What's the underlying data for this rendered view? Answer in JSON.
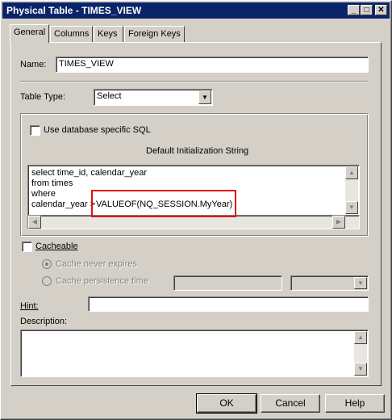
{
  "window": {
    "title": "Physical Table - TIMES_VIEW",
    "minimize_glyph": "_",
    "maximize_glyph": "□",
    "close_glyph": "✕"
  },
  "tabs": [
    {
      "label": "General"
    },
    {
      "label": "Columns"
    },
    {
      "label": "Keys"
    },
    {
      "label": "Foreign Keys"
    }
  ],
  "name": {
    "label": "Name:",
    "value": "TIMES_VIEW"
  },
  "table_type": {
    "label": "Table Type:",
    "value": "Select"
  },
  "sql_group": {
    "use_db_sql_label": "Use database specific SQL",
    "init_string_label": "Default Initialization String",
    "sql_lines": [
      "select time_id, calendar_year",
      "from times",
      "where",
      "calendar_year > "
    ],
    "highlighted_text": "VALUEOF(NQ_SESSION.MyYear)"
  },
  "cacheable": {
    "label": "Cacheable",
    "never_expires_label": "Cache never expires",
    "persistence_label": "Cache persistence time"
  },
  "hint": {
    "label": "Hint:",
    "value": ""
  },
  "description": {
    "label": "Description:",
    "value": ""
  },
  "buttons": {
    "ok": "OK",
    "cancel": "Cancel",
    "help": "Help"
  },
  "colors": {
    "titlebar": "#0a246a",
    "highlight_border": "#e01010",
    "face": "#d4d0c8"
  }
}
